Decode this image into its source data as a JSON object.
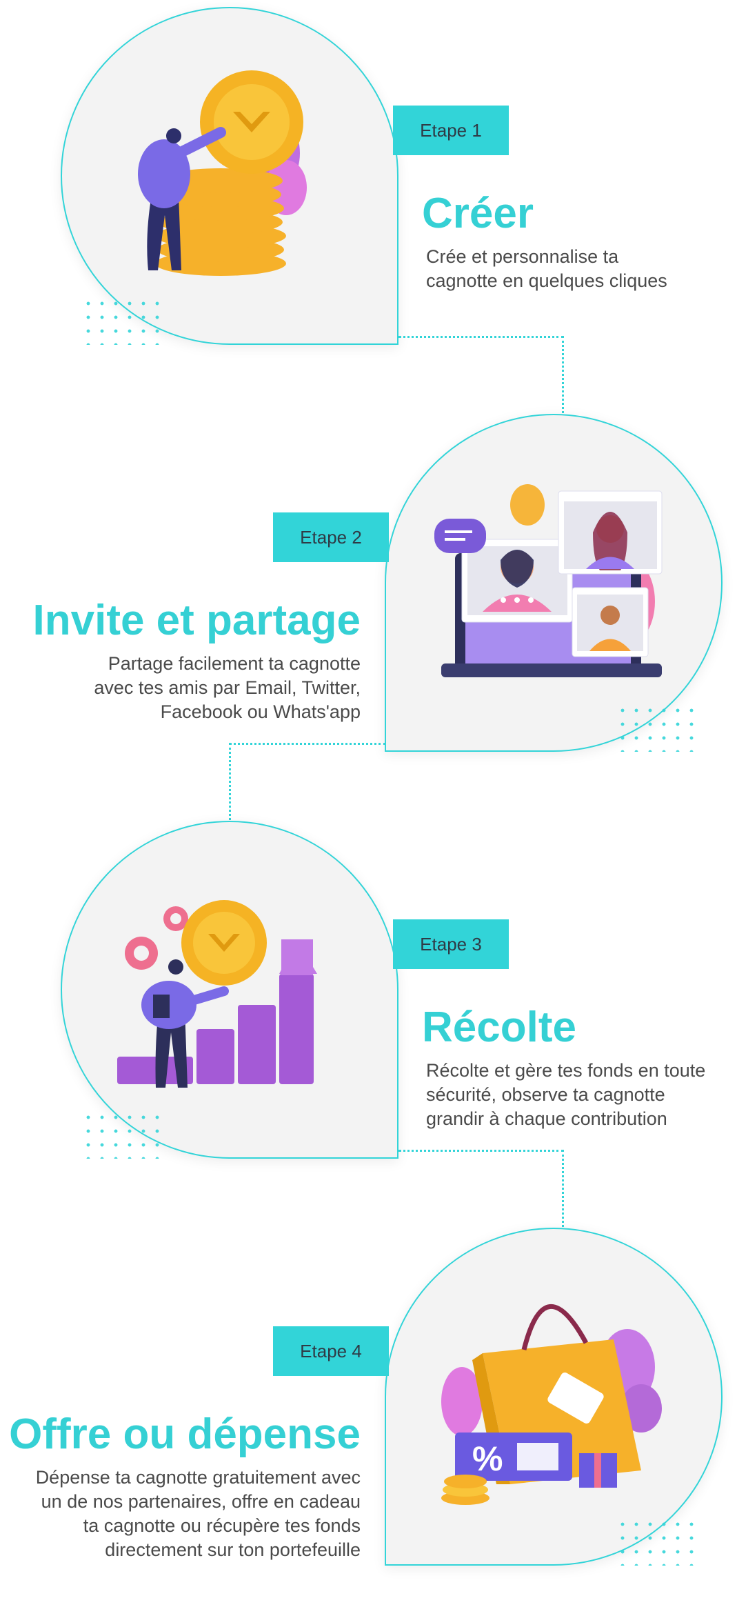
{
  "steps": [
    {
      "tag": "Etape 1",
      "title": "Créer",
      "desc": [
        "Crée et personnalise ta",
        "cagnotte en quelques cliques"
      ]
    },
    {
      "tag": "Etape 2",
      "title": "Invite et partage",
      "desc": [
        "Partage facilement ta cagnotte",
        "avec tes amis par Email, Twitter,",
        "Facebook ou Whats'app"
      ]
    },
    {
      "tag": "Etape 3",
      "title": "Récolte",
      "desc": [
        "Récolte et gère tes fonds en toute",
        "sécurité, observe ta cagnotte",
        "grandir à chaque contribution"
      ]
    },
    {
      "tag": "Etape 4",
      "title": "Offre ou dépense",
      "desc": [
        "Dépense ta cagnotte gratuitement avec",
        "un de nos partenaires, offre en cadeau",
        "ta cagnotte ou récupère tes fonds",
        "directement sur ton portefeuille"
      ]
    }
  ],
  "colors": {
    "accent": "#32d4d8",
    "title": "#35d0d4",
    "text": "#4a4a4a",
    "card": "#f3f3f3"
  },
  "icons": [
    "coins-illustration",
    "video-chat-illustration",
    "growth-chart-illustration",
    "shopping-illustration"
  ]
}
